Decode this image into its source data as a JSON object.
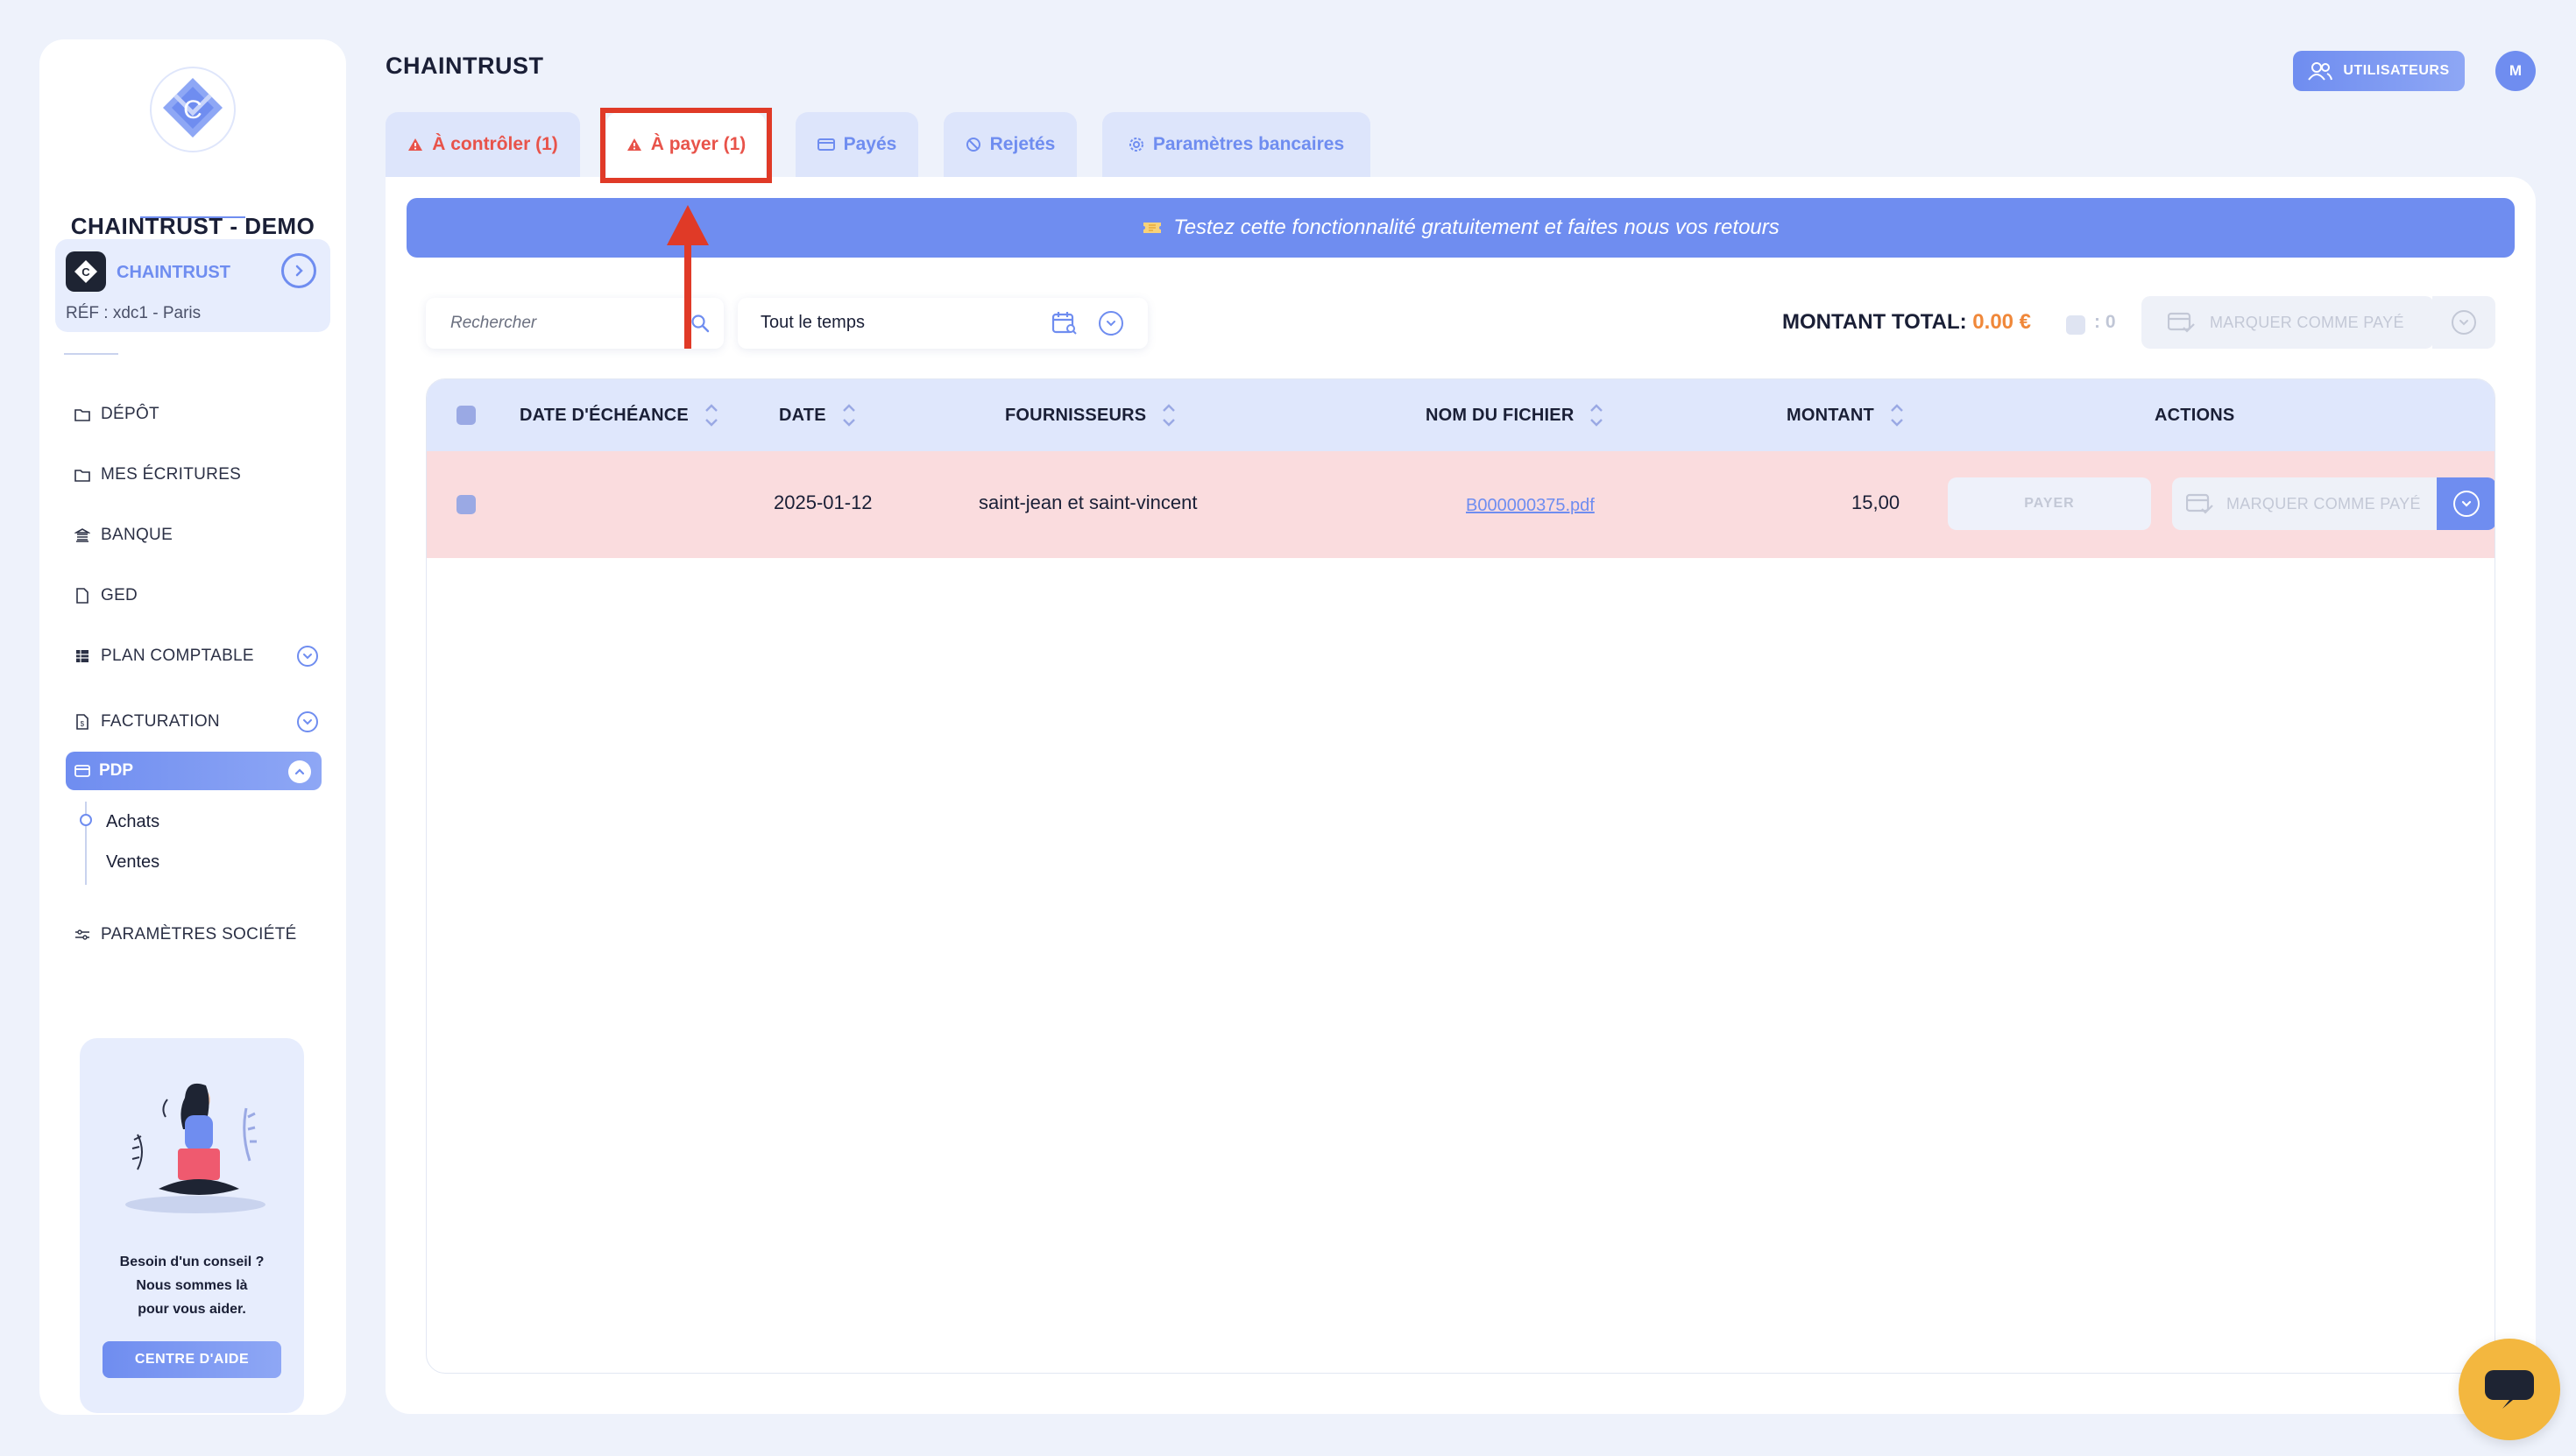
{
  "sidebar": {
    "org_name": "CHAINTRUST - DEMO",
    "company": {
      "name": "CHAINTRUST",
      "ref": "RÉF : xdc1 - Paris"
    },
    "nav": [
      {
        "label": "DÉPÔT",
        "icon": "folder-icon"
      },
      {
        "label": "MES ÉCRITURES",
        "icon": "folder-icon"
      },
      {
        "label": "BANQUE",
        "icon": "bank-icon"
      },
      {
        "label": "GED",
        "icon": "document-icon"
      },
      {
        "label": "PLAN COMPTABLE",
        "icon": "table-icon",
        "expandable": true
      },
      {
        "label": "FACTURATION",
        "icon": "invoice-icon",
        "expandable": true
      },
      {
        "label": "PDP",
        "icon": "card-icon",
        "active": true
      },
      {
        "label": "PARAMÈTRES SOCIÉTÉ",
        "icon": "sliders-icon"
      }
    ],
    "pdp_sub": [
      "Achats",
      "Ventes"
    ],
    "help": {
      "line1": "Besoin d'un conseil ?",
      "line2": "Nous sommes là",
      "line3": "pour vous aider.",
      "button": "CENTRE D'AIDE"
    }
  },
  "header": {
    "title": "CHAINTRUST",
    "users_button": "UTILISATEURS",
    "avatar_initial": "M"
  },
  "tabs": [
    {
      "label": "À contrôler (1)",
      "icon": "warning-icon",
      "state": "warn"
    },
    {
      "label": "À payer (1)",
      "icon": "warning-icon",
      "state": "active"
    },
    {
      "label": "Payés",
      "icon": "card-icon"
    },
    {
      "label": "Rejetés",
      "icon": "ban-icon"
    },
    {
      "label": "Paramètres bancaires",
      "icon": "gear-icon"
    }
  ],
  "banner": {
    "text": "Testez cette fonctionnalité gratuitement et faites nous vos retours"
  },
  "filters": {
    "search_placeholder": "Rechercher",
    "date_range": "Tout le temps"
  },
  "summary": {
    "total_label": "MONTANT TOTAL:",
    "total_value": "0.00 €",
    "selected_count": ": 0",
    "mark_paid": "MARQUER COMME PAYÉ"
  },
  "table": {
    "columns": [
      "DATE D'ÉCHÉANCE",
      "DATE",
      "FOURNISSEURS",
      "NOM DU FICHIER",
      "MONTANT",
      "ACTIONS"
    ],
    "rows": [
      {
        "due_date": "",
        "date": "2025-01-12",
        "supplier": "saint-jean et saint-vincent",
        "file": "B000000375.pdf",
        "amount": "15,00",
        "pay_label": "PAYER",
        "mark_paid_label": "MARQUER COMME PAYÉ"
      }
    ]
  },
  "colors": {
    "accent": "#6f8df0",
    "warn": "#e8534a",
    "highlight": "#e03a27",
    "total": "#f0883a",
    "row_bg": "#fadcde",
    "chat": "#f3b73f"
  }
}
